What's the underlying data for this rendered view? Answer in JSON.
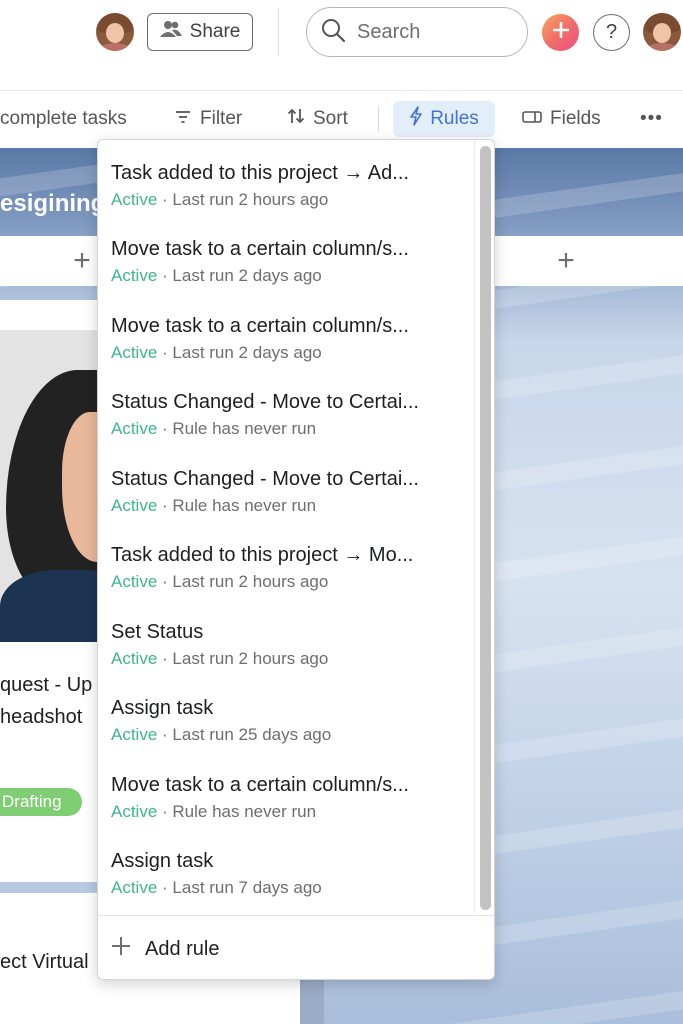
{
  "topbar": {
    "share_label": "Share",
    "search_placeholder": "Search",
    "help_label": "?"
  },
  "toolbar": {
    "incomplete_label": "complete tasks",
    "filter_label": "Filter",
    "sort_label": "Sort",
    "rules_label": "Rules",
    "fields_label": "Fields",
    "more_label": "•••"
  },
  "board": {
    "column_title": "esigining",
    "add_label": "+",
    "card_line1": "quest - Up",
    "card_line2": " headshot",
    "badge": "Drafting",
    "card2_text": "ect Virtual"
  },
  "rules": {
    "items": [
      {
        "title": "Task added to this project → Ad...",
        "status": "Active",
        "detail": "Last run 2 hours ago"
      },
      {
        "title": "Move task to a certain column/s...",
        "status": "Active",
        "detail": "Last run 2 days ago"
      },
      {
        "title": "Move task to a certain column/s...",
        "status": "Active",
        "detail": "Last run 2 days ago"
      },
      {
        "title": "Status Changed - Move to Certai...",
        "status": "Active",
        "detail": "Rule has never run"
      },
      {
        "title": "Status Changed - Move to Certai...",
        "status": "Active",
        "detail": "Rule has never run"
      },
      {
        "title": "Task added to this project → Mo...",
        "status": "Active",
        "detail": "Last run 2 hours ago"
      },
      {
        "title": "Set Status",
        "status": "Active",
        "detail": "Last run 2 hours ago"
      },
      {
        "title": "Assign task",
        "status": "Active",
        "detail": "Last run 25 days ago"
      },
      {
        "title": "Move task to a certain column/s...",
        "status": "Active",
        "detail": "Rule has never run"
      },
      {
        "title": "Assign task",
        "status": "Active",
        "detail": "Last run 7 days ago"
      }
    ],
    "separator": " · ",
    "add_rule_label": "Add rule"
  },
  "colors": {
    "accent": "#4573d2",
    "active_green": "#3fb58a",
    "badge_green": "#7fce73"
  }
}
